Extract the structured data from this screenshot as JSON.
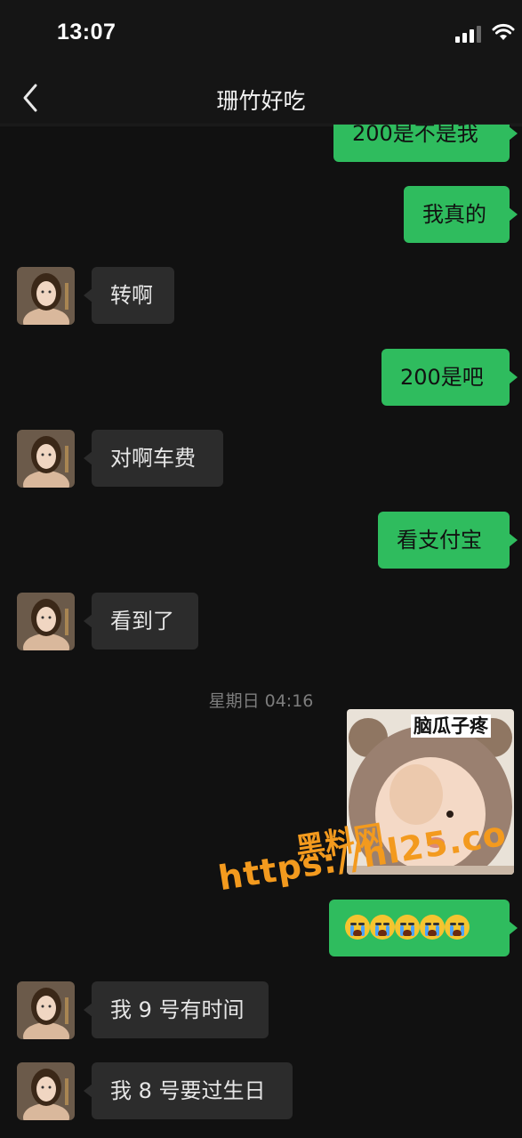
{
  "status_bar": {
    "time": "13:07",
    "signal_icon": "cellular-signal-icon",
    "wifi_icon": "wifi-icon"
  },
  "nav": {
    "back_icon": "chevron-left-icon",
    "title": "珊竹好吃"
  },
  "messages": [
    {
      "side": "out",
      "text": "200是不是我"
    },
    {
      "side": "out",
      "text": "我真的"
    },
    {
      "side": "in",
      "text": "转啊"
    },
    {
      "side": "out",
      "text": "200是吧"
    },
    {
      "side": "in",
      "text": "对啊车费"
    },
    {
      "side": "out",
      "text": "看支付宝"
    },
    {
      "side": "in",
      "text": "看到了"
    },
    {
      "side": "timestamp",
      "text": "星期日 04:16"
    },
    {
      "side": "out",
      "type": "sticker",
      "caption": "脑瓜子疼"
    },
    {
      "side": "out",
      "type": "emoji",
      "emoji": "loudly-crying-face",
      "count": 5
    },
    {
      "side": "in",
      "text": "我 9 号有时间"
    },
    {
      "side": "in",
      "text": "我 8 号要过生日"
    }
  ],
  "watermark": {
    "line1": "黑料网",
    "line2": "https://hl25.co"
  },
  "colors": {
    "background": "#111111",
    "outgoing_bubble": "#2fbc5e",
    "incoming_bubble": "#2c2c2c",
    "watermark": "#f39a1e"
  }
}
